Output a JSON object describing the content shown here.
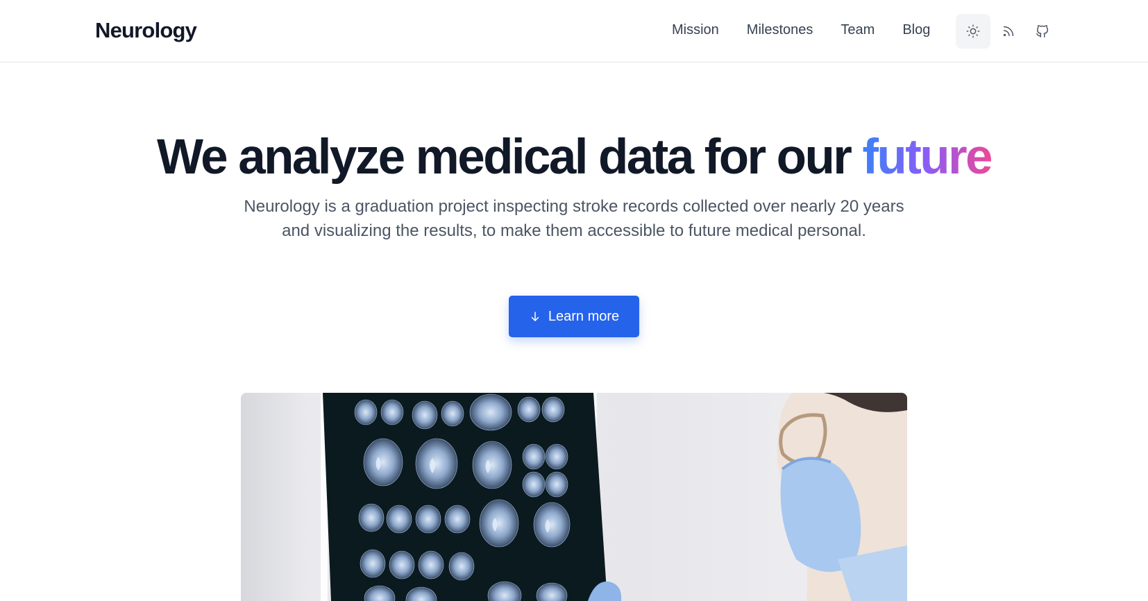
{
  "header": {
    "brand": "Neurology",
    "nav": [
      {
        "label": "Mission"
      },
      {
        "label": "Milestones"
      },
      {
        "label": "Team"
      },
      {
        "label": "Blog"
      }
    ],
    "icons": {
      "theme_toggle": "sun-icon",
      "rss": "rss-icon",
      "github": "github-icon"
    }
  },
  "hero": {
    "title_main": "We analyze medical data for our ",
    "title_accent": "future",
    "subtitle": "Neurology is a graduation project inspecting stroke records collected over nearly 20 years and visualizing the results, to make them accessible to future medical personal.",
    "cta_label": "Learn more",
    "cta_icon": "arrow-down-icon"
  },
  "colors": {
    "accent_gradient": [
      "#3b82f6",
      "#8b5cf6",
      "#ec4899"
    ],
    "button": "#2563eb",
    "text_dark": "#111827",
    "text_muted": "#4b5563"
  }
}
